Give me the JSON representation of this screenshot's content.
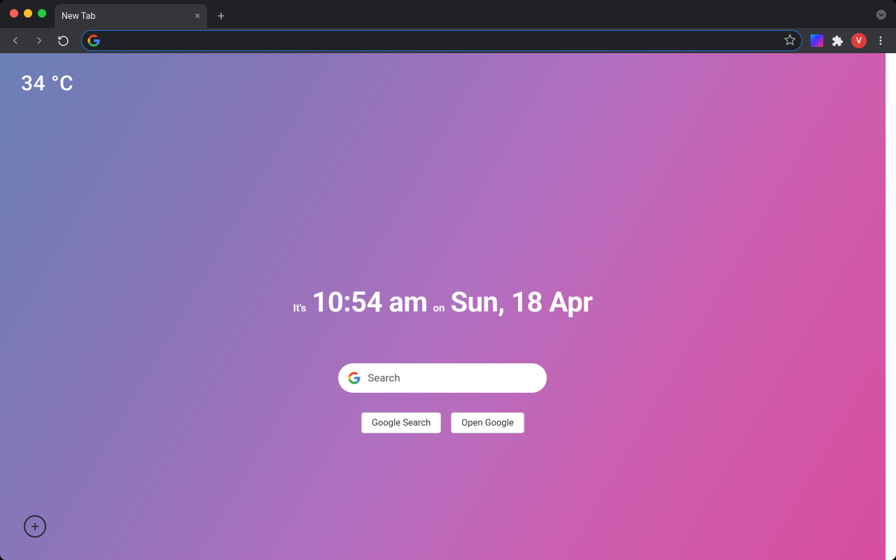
{
  "browser": {
    "tab_title": "New Tab",
    "address_value": "",
    "avatar_initial": "V"
  },
  "page": {
    "weather": "34 °C",
    "clock": {
      "prefix": "It's",
      "time": "10:54 am",
      "separator": "on",
      "date": "Sun, 18 Apr"
    },
    "search_placeholder": "Search",
    "buttons": {
      "google_search": "Google Search",
      "open_google": "Open Google"
    }
  }
}
